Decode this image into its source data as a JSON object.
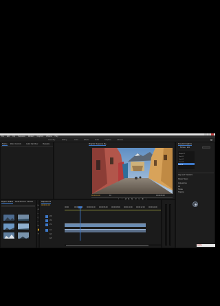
{
  "window": {
    "title": ""
  },
  "menu": [
    "File",
    "Edit",
    "Clip",
    "Sequence",
    "Markers",
    "Graphics",
    "Window",
    "Help"
  ],
  "workspaces": [
    "Assembly",
    "Editing",
    "Color",
    "Effects",
    "Audio",
    "Graphics",
    "Libraries"
  ],
  "source_panel": {
    "tabs": [
      "Source",
      "Effect Controls",
      "Audio Clip Mixer",
      "Metadata"
    ]
  },
  "program_panel": {
    "title": "Program: Sequence 01",
    "timecode": "00:00:01:00",
    "fit": "Fit",
    "quality": "Full",
    "duration": "00:00:08:08"
  },
  "essential_panel": {
    "title": "Essential Graphics",
    "tabs": [
      "Browse",
      "Edit"
    ],
    "rows": [
      "Shape 01",
      "Text 01",
      "Text 02",
      "Text 03",
      "Text 04"
    ],
    "section_labels": [
      "Align and Transform",
      "Master Styles",
      "Appearance",
      "Fill",
      "Stroke",
      "Shadow"
    ],
    "badge": "Adobe"
  },
  "project_panel": {
    "tabs": [
      "Project: Untitled",
      "Media Browser",
      "Libraries"
    ],
    "items": [
      {
        "name": "Clip 01",
        "duration": "5:00"
      },
      {
        "name": "Clip 02",
        "duration": "4:12"
      },
      {
        "name": "Clip 03",
        "duration": "6:08"
      },
      {
        "name": "Clip 04",
        "duration": "3:20"
      },
      {
        "name": "Clip 05",
        "duration": "7:01"
      },
      {
        "name": "Clip 06",
        "duration": "2:18"
      }
    ]
  },
  "timeline": {
    "tab": "Sequence 01",
    "timecode": "00:00:01:00",
    "rulers": [
      "00:00",
      "00:00:02:00",
      "00:00:04:00",
      "00:00:06:00",
      "00:00:08:00",
      "00:00:10:00",
      "00:00:12:00",
      "00:00:14:00"
    ],
    "tracks": [
      "V3",
      "V2",
      "V1",
      "A1",
      "A2",
      "A3"
    ]
  },
  "colors": {
    "accent": "#3d78c8",
    "clip_video": "#6a8cb3",
    "clip_audio": "#5b6f8a",
    "playhead": "#3d78c8",
    "window_chrome": "#e6e6e6"
  }
}
